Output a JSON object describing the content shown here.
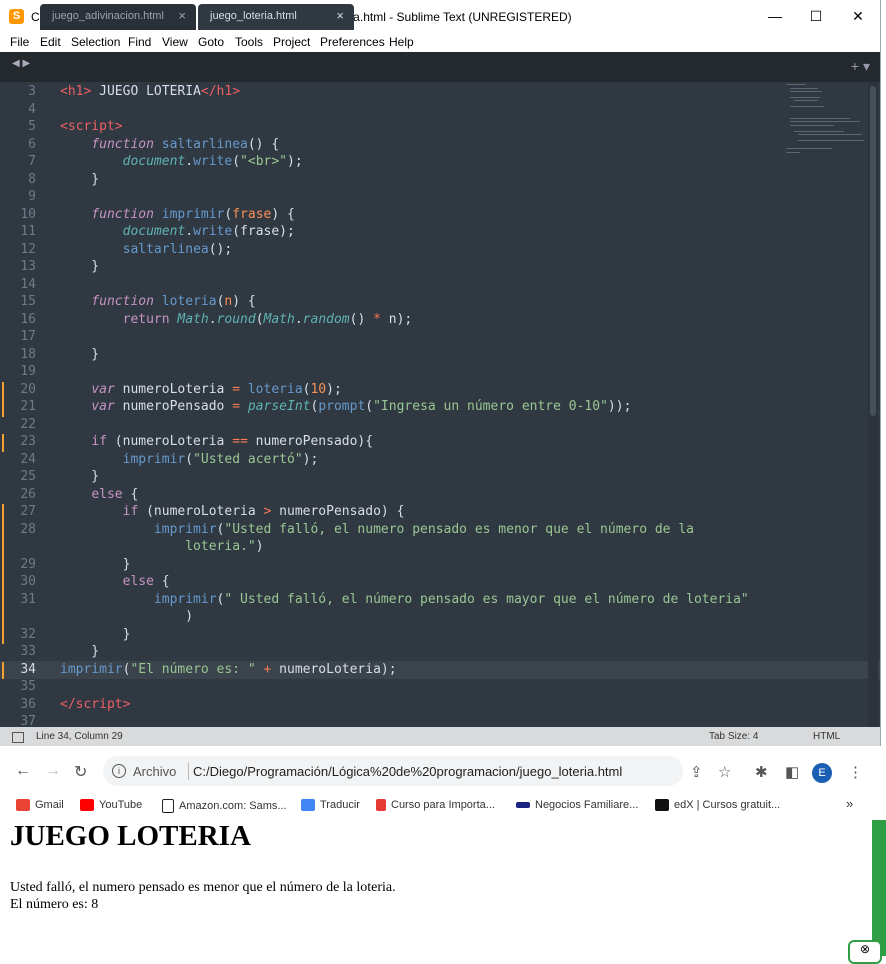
{
  "sublime": {
    "title": "C:\\Diego\\Programación\\Lógica de programacion\\juego_loteria.html - Sublime Text (UNREGISTERED)",
    "menu": [
      "File",
      "Edit",
      "Selection",
      "Find",
      "View",
      "Goto",
      "Tools",
      "Project",
      "Preferences",
      "Help"
    ],
    "tabs": [
      {
        "label": "juego_adivinacion.html",
        "active": false
      },
      {
        "label": "juego_loteria.html",
        "active": true
      }
    ],
    "status": {
      "position": "Line 34, Column 29",
      "tab_size": "Tab Size: 4",
      "syntax": "HTML"
    }
  },
  "code_lines": [
    {
      "n": "3",
      "html": "<span class='t'>&lt;h1&gt;</span> JUEGO LOTERIA<span class='t'>&lt;/h1&gt;</span>"
    },
    {
      "n": "4",
      "html": ""
    },
    {
      "n": "5",
      "html": "<span class='t'>&lt;script&gt;</span>"
    },
    {
      "n": "6",
      "html": "    <span class='k'>function</span> <span class='f'>saltarlinea</span>() {"
    },
    {
      "n": "7",
      "html": "        <span class='o'>document</span>.<span class='f'>write</span>(<span class='s'>\"&lt;br&gt;\"</span>);"
    },
    {
      "n": "8",
      "html": "    }"
    },
    {
      "n": "9",
      "html": ""
    },
    {
      "n": "10",
      "html": "    <span class='k'>function</span> <span class='f'>imprimir</span>(<span class='p'>frase</span>) {"
    },
    {
      "n": "11",
      "html": "        <span class='o'>document</span>.<span class='f'>write</span>(frase);"
    },
    {
      "n": "12",
      "html": "        <span class='f'>saltarlinea</span>();"
    },
    {
      "n": "13",
      "html": "    }"
    },
    {
      "n": "14",
      "html": ""
    },
    {
      "n": "15",
      "html": "    <span class='k'>function</span> <span class='f'>loteria</span>(<span class='p'>n</span>) {"
    },
    {
      "n": "16",
      "html": "        <span class='kw'>return</span> <span class='o'>Math</span>.<span class='o'>round</span>(<span class='o'>Math</span>.<span class='o'>random</span>() <span class='op'>*</span> n);"
    },
    {
      "n": "17",
      "html": ""
    },
    {
      "n": "18",
      "html": "    }"
    },
    {
      "n": "19",
      "html": ""
    },
    {
      "n": "20",
      "html": "    <span class='k'>var</span> numeroLoteria <span class='op'>=</span> <span class='f'>loteria</span>(<span class='p'>10</span>);",
      "mark": true
    },
    {
      "n": "21",
      "html": "    <span class='k'>var</span> numeroPensado <span class='op'>=</span> <span class='o'>parseInt</span>(<span class='f'>prompt</span>(<span class='s'>\"Ingresa un número entre 0-10\"</span>));",
      "mark": true
    },
    {
      "n": "22",
      "html": ""
    },
    {
      "n": "23",
      "html": "    <span class='kw'>if</span> (numeroLoteria <span class='op'>==</span> numeroPensado){",
      "mark": true
    },
    {
      "n": "24",
      "html": "        <span class='f'>imprimir</span>(<span class='s'>\"Usted acertó\"</span>);"
    },
    {
      "n": "25",
      "html": "    }"
    },
    {
      "n": "26",
      "html": "    <span class='kw'>else</span> {"
    },
    {
      "n": "27",
      "html": "        <span class='kw'>if</span> (numeroLoteria <span class='op'>&gt;</span> numeroPensado) {",
      "mark": true
    },
    {
      "n": "28",
      "html": "            <span class='f'>imprimir</span>(<span class='s'>\"Usted falló, el numero pensado es menor que el número de la</span>",
      "mark": true
    },
    {
      "n": "",
      "html": "                <span class='s'>loteria.\"</span>)",
      "mark": true
    },
    {
      "n": "29",
      "html": "        }",
      "mark": true
    },
    {
      "n": "30",
      "html": "        <span class='kw'>else</span> {",
      "mark": true
    },
    {
      "n": "31",
      "html": "            <span class='f'>imprimir</span>(<span class='s'>\" Usted falló, el número pensado es mayor que el número de loteria\"</span>",
      "mark": true
    },
    {
      "n": "",
      "html": "                )",
      "mark": true
    },
    {
      "n": "32",
      "html": "        }",
      "mark": true
    },
    {
      "n": "33",
      "html": "    }"
    },
    {
      "n": "34",
      "html": "<span class='f'>imprimir</span>(<span class='s'>\"El número es: \"</span> <span class='op'>+</span> numeroLoteria);",
      "mark": true,
      "current": true
    },
    {
      "n": "35",
      "html": ""
    },
    {
      "n": "36",
      "html": "<span class='t'>&lt;/script&gt;</span>"
    },
    {
      "n": "37",
      "html": ""
    }
  ],
  "browser": {
    "url_prefix": "Archivo",
    "url": "C:/Diego/Programación/Lógica%20de%20programacion/juego_loteria.html",
    "profile_initial": "E",
    "bookmarks": [
      {
        "label": "Gmail",
        "color": "#ea4335"
      },
      {
        "label": "YouTube",
        "color": "#ff0000"
      },
      {
        "label": "Amazon.com: Sams...",
        "color": "#222222"
      },
      {
        "label": "Traducir",
        "color": "#4285f4"
      },
      {
        "label": "Curso para Importa...",
        "color": "#e53935"
      },
      {
        "label": "Negocios Familiare...",
        "color": "#1a237e"
      },
      {
        "label": "edX | Cursos gratuit...",
        "color": "#111111"
      }
    ],
    "more": "»"
  },
  "page": {
    "heading": "JUEGO LOTERIA",
    "line1": "Usted falló, el numero pensado es menor que el número de la loteria.",
    "line2": "El número es: 8"
  }
}
